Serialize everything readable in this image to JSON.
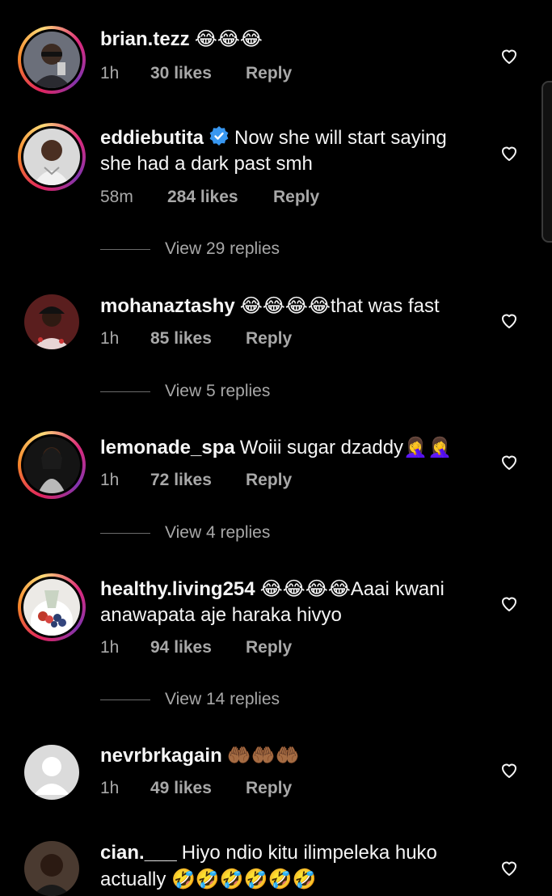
{
  "comments": [
    {
      "username": "brian.tezz",
      "text": "",
      "emoji": "😂😂😂",
      "time": "1h",
      "likes": "30 likes",
      "reply": "Reply"
    },
    {
      "username": "eddiebutita",
      "text": "Now she will start saying she had a dark past smh",
      "time": "58m",
      "likes": "284 likes",
      "reply": "Reply",
      "verified": true,
      "view_replies": "View 29 replies"
    },
    {
      "username": "mohanaztashy",
      "emoji": "😂😂😂😂",
      "text": "that was fast",
      "time": "1h",
      "likes": "85 likes",
      "reply": "Reply",
      "view_replies": "View 5 replies"
    },
    {
      "username": "lemonade_spa",
      "text": "Woiii sugar dzaddy",
      "emoji": "🤦‍♀️🤦‍♀️",
      "time": "1h",
      "likes": "72 likes",
      "reply": "Reply",
      "view_replies": "View 4 replies"
    },
    {
      "username": "healthy.living254",
      "emoji": "😂😂😂😂",
      "text": "Aaai kwani anawapata aje haraka hivyo",
      "time": "1h",
      "likes": "94 likes",
      "reply": "Reply",
      "view_replies": "View 14 replies"
    },
    {
      "username": "nevrbrkagain",
      "emoji": "🤲🏾🤲🏾🤲🏾",
      "text": "",
      "time": "1h",
      "likes": "49 likes",
      "reply": "Reply"
    },
    {
      "username": "cian.___",
      "text": "Hiyo ndio kitu ilimpeleka huko actually",
      "emoji": "🤣🤣🤣🤣🤣🤣"
    }
  ],
  "colors": {
    "background": "#000000",
    "text": "#f5f5f5",
    "muted": "#a8a8a8",
    "verified": "#3897f0"
  },
  "icons": {
    "like": "heart-outline-icon",
    "verified": "verified-badge-icon"
  }
}
